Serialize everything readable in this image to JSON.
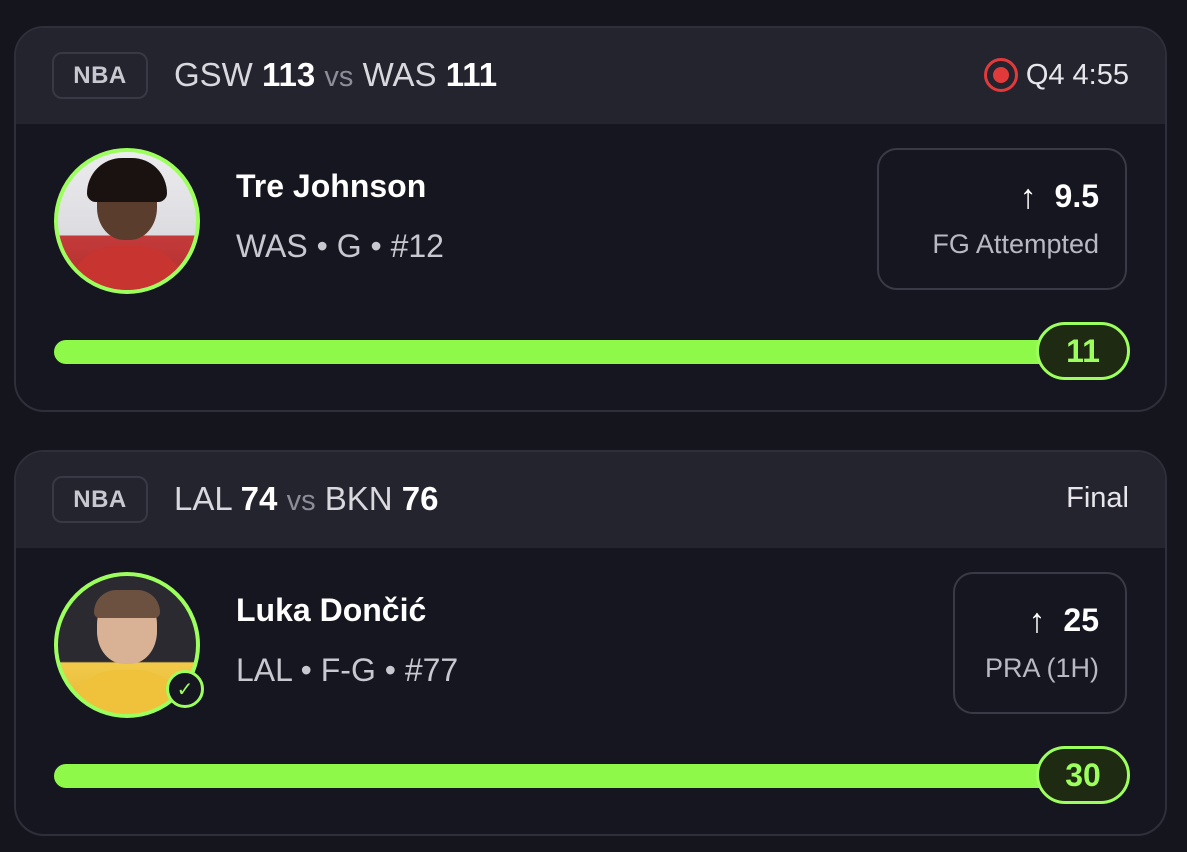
{
  "cards": [
    {
      "league": "NBA",
      "team_a": "GSW",
      "score_a": "113",
      "vs": "vs",
      "team_b": "WAS",
      "score_b": "111",
      "status": "Q4 4:55",
      "status_icon": "live-record-icon",
      "player": {
        "name": "Tre Johnson",
        "meta": "WAS • G • #12"
      },
      "pick": {
        "direction_icon": "arrow-up-icon",
        "line": "9.5",
        "stat": "FG Attempted"
      },
      "progress": {
        "value_label": "11",
        "fill_fraction": 1.0
      }
    },
    {
      "league": "NBA",
      "team_a": "LAL",
      "score_a": "74",
      "vs": "vs",
      "team_b": "BKN",
      "score_b": "76",
      "status": "Final",
      "player": {
        "name": "Luka Dončić",
        "meta": "LAL • F-G • #77",
        "verified_icon": "check-circle-icon"
      },
      "pick": {
        "direction_icon": "arrow-up-icon",
        "line": "25",
        "stat": "PRA (1H)"
      },
      "progress": {
        "value_label": "30",
        "fill_fraction": 1.0
      }
    }
  ],
  "colors": {
    "accent_green": "#9dff5e",
    "live_red": "#e23a3a",
    "background": "#15151d"
  }
}
